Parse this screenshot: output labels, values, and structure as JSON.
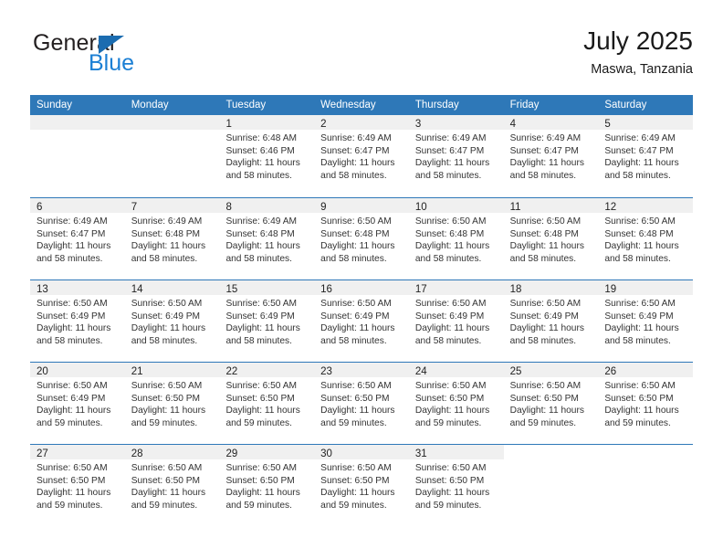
{
  "brand": {
    "name_top": "General",
    "name_bottom": "Blue",
    "triangle_color": "#1b6cb0",
    "blue_color": "#1b7fd4"
  },
  "header": {
    "title": "July 2025",
    "subtitle": "Maswa, Tanzania"
  },
  "colors": {
    "header_row": "#2e78b8",
    "date_strip": "#f0f0f0",
    "text": "#333333"
  },
  "weekday_headers": [
    "Sunday",
    "Monday",
    "Tuesday",
    "Wednesday",
    "Thursday",
    "Friday",
    "Saturday"
  ],
  "labels": {
    "sunrise_prefix": "Sunrise: ",
    "sunset_prefix": "Sunset: ",
    "daylight_prefix": "Daylight: "
  },
  "weeks": [
    [
      {
        "day": "",
        "empty": true
      },
      {
        "day": "",
        "empty": true
      },
      {
        "day": "1",
        "sunrise": "Sunrise: 6:48 AM",
        "sunset": "Sunset: 6:46 PM",
        "daylight_l1": "Daylight: 11 hours",
        "daylight_l2": "and 58 minutes."
      },
      {
        "day": "2",
        "sunrise": "Sunrise: 6:49 AM",
        "sunset": "Sunset: 6:47 PM",
        "daylight_l1": "Daylight: 11 hours",
        "daylight_l2": "and 58 minutes."
      },
      {
        "day": "3",
        "sunrise": "Sunrise: 6:49 AM",
        "sunset": "Sunset: 6:47 PM",
        "daylight_l1": "Daylight: 11 hours",
        "daylight_l2": "and 58 minutes."
      },
      {
        "day": "4",
        "sunrise": "Sunrise: 6:49 AM",
        "sunset": "Sunset: 6:47 PM",
        "daylight_l1": "Daylight: 11 hours",
        "daylight_l2": "and 58 minutes."
      },
      {
        "day": "5",
        "sunrise": "Sunrise: 6:49 AM",
        "sunset": "Sunset: 6:47 PM",
        "daylight_l1": "Daylight: 11 hours",
        "daylight_l2": "and 58 minutes."
      }
    ],
    [
      {
        "day": "6",
        "sunrise": "Sunrise: 6:49 AM",
        "sunset": "Sunset: 6:47 PM",
        "daylight_l1": "Daylight: 11 hours",
        "daylight_l2": "and 58 minutes."
      },
      {
        "day": "7",
        "sunrise": "Sunrise: 6:49 AM",
        "sunset": "Sunset: 6:48 PM",
        "daylight_l1": "Daylight: 11 hours",
        "daylight_l2": "and 58 minutes."
      },
      {
        "day": "8",
        "sunrise": "Sunrise: 6:49 AM",
        "sunset": "Sunset: 6:48 PM",
        "daylight_l1": "Daylight: 11 hours",
        "daylight_l2": "and 58 minutes."
      },
      {
        "day": "9",
        "sunrise": "Sunrise: 6:50 AM",
        "sunset": "Sunset: 6:48 PM",
        "daylight_l1": "Daylight: 11 hours",
        "daylight_l2": "and 58 minutes."
      },
      {
        "day": "10",
        "sunrise": "Sunrise: 6:50 AM",
        "sunset": "Sunset: 6:48 PM",
        "daylight_l1": "Daylight: 11 hours",
        "daylight_l2": "and 58 minutes."
      },
      {
        "day": "11",
        "sunrise": "Sunrise: 6:50 AM",
        "sunset": "Sunset: 6:48 PM",
        "daylight_l1": "Daylight: 11 hours",
        "daylight_l2": "and 58 minutes."
      },
      {
        "day": "12",
        "sunrise": "Sunrise: 6:50 AM",
        "sunset": "Sunset: 6:48 PM",
        "daylight_l1": "Daylight: 11 hours",
        "daylight_l2": "and 58 minutes."
      }
    ],
    [
      {
        "day": "13",
        "sunrise": "Sunrise: 6:50 AM",
        "sunset": "Sunset: 6:49 PM",
        "daylight_l1": "Daylight: 11 hours",
        "daylight_l2": "and 58 minutes."
      },
      {
        "day": "14",
        "sunrise": "Sunrise: 6:50 AM",
        "sunset": "Sunset: 6:49 PM",
        "daylight_l1": "Daylight: 11 hours",
        "daylight_l2": "and 58 minutes."
      },
      {
        "day": "15",
        "sunrise": "Sunrise: 6:50 AM",
        "sunset": "Sunset: 6:49 PM",
        "daylight_l1": "Daylight: 11 hours",
        "daylight_l2": "and 58 minutes."
      },
      {
        "day": "16",
        "sunrise": "Sunrise: 6:50 AM",
        "sunset": "Sunset: 6:49 PM",
        "daylight_l1": "Daylight: 11 hours",
        "daylight_l2": "and 58 minutes."
      },
      {
        "day": "17",
        "sunrise": "Sunrise: 6:50 AM",
        "sunset": "Sunset: 6:49 PM",
        "daylight_l1": "Daylight: 11 hours",
        "daylight_l2": "and 58 minutes."
      },
      {
        "day": "18",
        "sunrise": "Sunrise: 6:50 AM",
        "sunset": "Sunset: 6:49 PM",
        "daylight_l1": "Daylight: 11 hours",
        "daylight_l2": "and 58 minutes."
      },
      {
        "day": "19",
        "sunrise": "Sunrise: 6:50 AM",
        "sunset": "Sunset: 6:49 PM",
        "daylight_l1": "Daylight: 11 hours",
        "daylight_l2": "and 58 minutes."
      }
    ],
    [
      {
        "day": "20",
        "sunrise": "Sunrise: 6:50 AM",
        "sunset": "Sunset: 6:49 PM",
        "daylight_l1": "Daylight: 11 hours",
        "daylight_l2": "and 59 minutes."
      },
      {
        "day": "21",
        "sunrise": "Sunrise: 6:50 AM",
        "sunset": "Sunset: 6:50 PM",
        "daylight_l1": "Daylight: 11 hours",
        "daylight_l2": "and 59 minutes."
      },
      {
        "day": "22",
        "sunrise": "Sunrise: 6:50 AM",
        "sunset": "Sunset: 6:50 PM",
        "daylight_l1": "Daylight: 11 hours",
        "daylight_l2": "and 59 minutes."
      },
      {
        "day": "23",
        "sunrise": "Sunrise: 6:50 AM",
        "sunset": "Sunset: 6:50 PM",
        "daylight_l1": "Daylight: 11 hours",
        "daylight_l2": "and 59 minutes."
      },
      {
        "day": "24",
        "sunrise": "Sunrise: 6:50 AM",
        "sunset": "Sunset: 6:50 PM",
        "daylight_l1": "Daylight: 11 hours",
        "daylight_l2": "and 59 minutes."
      },
      {
        "day": "25",
        "sunrise": "Sunrise: 6:50 AM",
        "sunset": "Sunset: 6:50 PM",
        "daylight_l1": "Daylight: 11 hours",
        "daylight_l2": "and 59 minutes."
      },
      {
        "day": "26",
        "sunrise": "Sunrise: 6:50 AM",
        "sunset": "Sunset: 6:50 PM",
        "daylight_l1": "Daylight: 11 hours",
        "daylight_l2": "and 59 minutes."
      }
    ],
    [
      {
        "day": "27",
        "sunrise": "Sunrise: 6:50 AM",
        "sunset": "Sunset: 6:50 PM",
        "daylight_l1": "Daylight: 11 hours",
        "daylight_l2": "and 59 minutes."
      },
      {
        "day": "28",
        "sunrise": "Sunrise: 6:50 AM",
        "sunset": "Sunset: 6:50 PM",
        "daylight_l1": "Daylight: 11 hours",
        "daylight_l2": "and 59 minutes."
      },
      {
        "day": "29",
        "sunrise": "Sunrise: 6:50 AM",
        "sunset": "Sunset: 6:50 PM",
        "daylight_l1": "Daylight: 11 hours",
        "daylight_l2": "and 59 minutes."
      },
      {
        "day": "30",
        "sunrise": "Sunrise: 6:50 AM",
        "sunset": "Sunset: 6:50 PM",
        "daylight_l1": "Daylight: 11 hours",
        "daylight_l2": "and 59 minutes."
      },
      {
        "day": "31",
        "sunrise": "Sunrise: 6:50 AM",
        "sunset": "Sunset: 6:50 PM",
        "daylight_l1": "Daylight: 11 hours",
        "daylight_l2": "and 59 minutes."
      },
      {
        "day": "",
        "empty": true,
        "no_strip": true
      },
      {
        "day": "",
        "empty": true,
        "no_strip": true
      }
    ]
  ]
}
